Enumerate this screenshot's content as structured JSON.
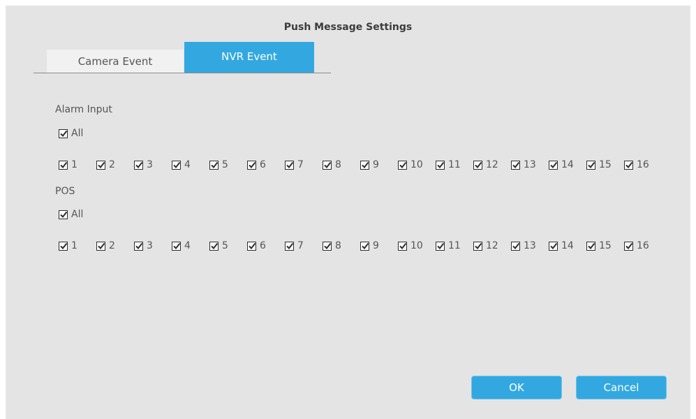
{
  "dialog": {
    "title": "Push Message Settings"
  },
  "tabs": [
    {
      "label": "Camera Event",
      "active": false
    },
    {
      "label": "NVR Event",
      "active": true
    }
  ],
  "alarm_input": {
    "label": "Alarm Input",
    "all": {
      "label": "All",
      "checked": true
    },
    "channels": [
      "1",
      "2",
      "3",
      "4",
      "5",
      "6",
      "7",
      "8",
      "9",
      "10",
      "11",
      "12",
      "13",
      "14",
      "15",
      "16"
    ]
  },
  "pos": {
    "label": "POS",
    "all": {
      "label": "All",
      "checked": true
    },
    "channels": [
      "1",
      "2",
      "3",
      "4",
      "5",
      "6",
      "7",
      "8",
      "9",
      "10",
      "11",
      "12",
      "13",
      "14",
      "15",
      "16"
    ]
  },
  "buttons": {
    "ok": "OK",
    "cancel": "Cancel"
  },
  "colors": {
    "accent": "#33a8e0",
    "dialog_bg": "#e4e4e4",
    "inactive_tab": "#f1f1f1"
  }
}
